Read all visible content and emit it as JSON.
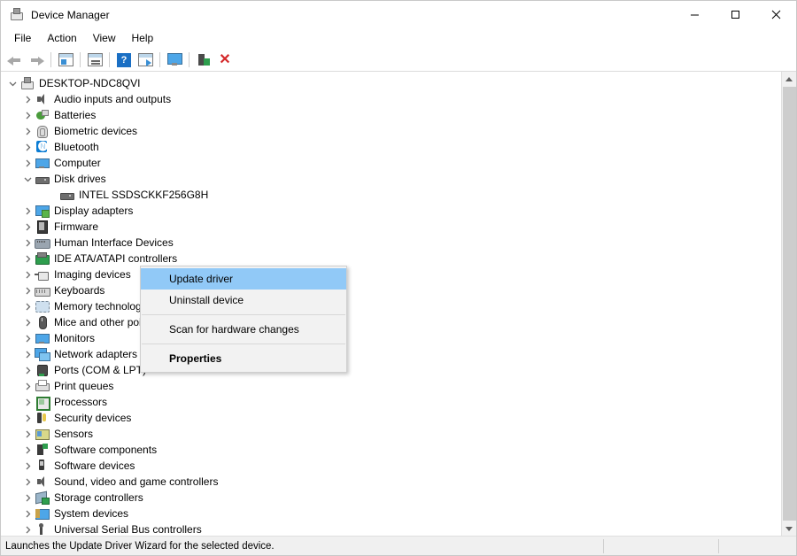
{
  "window": {
    "title": "Device Manager",
    "icon": "device-manager-icon",
    "controls": {
      "minimize": "—",
      "maximize": "☐",
      "close": "✕"
    }
  },
  "menubar": {
    "items": [
      {
        "label": "File"
      },
      {
        "label": "Action"
      },
      {
        "label": "View"
      },
      {
        "label": "Help"
      }
    ]
  },
  "toolbar": {
    "buttons": [
      {
        "name": "back-icon",
        "title": "Back"
      },
      {
        "name": "forward-icon",
        "title": "Forward"
      },
      {
        "name": "show-hide-console-tree-icon",
        "title": "Show/Hide Console Tree"
      },
      {
        "name": "properties-icon",
        "title": "Properties"
      },
      {
        "name": "help-icon",
        "title": "Help"
      },
      {
        "name": "update-driver-icon",
        "title": "Update Driver"
      },
      {
        "name": "scan-for-hardware-changes-icon",
        "title": "Scan for hardware changes"
      },
      {
        "name": "disable-device-icon",
        "title": "Disable device"
      },
      {
        "name": "uninstall-device-icon",
        "title": "Uninstall device"
      }
    ]
  },
  "tree": {
    "nodes": [
      {
        "label": "DESKTOP-NDC8QVI",
        "depth": 0,
        "state": "expanded",
        "icon": "computer-root-icon",
        "iconclass": "i-pc"
      },
      {
        "label": "Audio inputs and outputs",
        "depth": 1,
        "state": "collapsed",
        "icon": "audio-icon",
        "iconclass": "i-speaker"
      },
      {
        "label": "Batteries",
        "depth": 1,
        "state": "collapsed",
        "icon": "battery-icon",
        "iconclass": "i-batt"
      },
      {
        "label": "Biometric devices",
        "depth": 1,
        "state": "collapsed",
        "icon": "fingerprint-icon",
        "iconclass": "i-finger"
      },
      {
        "label": "Bluetooth",
        "depth": 1,
        "state": "collapsed",
        "icon": "bluetooth-icon",
        "iconclass": "i-bt"
      },
      {
        "label": "Computer",
        "depth": 1,
        "state": "collapsed",
        "icon": "computer-icon",
        "iconclass": "i-monitor"
      },
      {
        "label": "Disk drives",
        "depth": 1,
        "state": "expanded",
        "icon": "disk-drive-icon",
        "iconclass": "i-disk"
      },
      {
        "label": "INTEL SSDSCKKF256G8H",
        "depth": 2,
        "state": "leaf",
        "icon": "disk-drive-icon",
        "iconclass": "i-disk"
      },
      {
        "label": "Display adapters",
        "depth": 1,
        "state": "collapsed",
        "icon": "display-adapter-icon",
        "iconclass": "i-display"
      },
      {
        "label": "Firmware",
        "depth": 1,
        "state": "collapsed",
        "icon": "firmware-icon",
        "iconclass": "i-fw"
      },
      {
        "label": "Human Interface Devices",
        "depth": 1,
        "state": "collapsed",
        "icon": "human-interface-device-icon",
        "iconclass": "i-hid"
      },
      {
        "label": "IDE ATA/ATAPI controllers",
        "depth": 1,
        "state": "collapsed",
        "icon": "ide-controller-icon",
        "iconclass": "i-ide"
      },
      {
        "label": "Imaging devices",
        "depth": 1,
        "state": "collapsed",
        "icon": "imaging-device-icon",
        "iconclass": "i-imaging"
      },
      {
        "label": "Keyboards",
        "depth": 1,
        "state": "collapsed",
        "icon": "keyboard-icon",
        "iconclass": "i-kbd"
      },
      {
        "label": "Memory technology devices",
        "depth": 1,
        "state": "collapsed",
        "icon": "memory-technology-icon",
        "iconclass": "i-mem"
      },
      {
        "label": "Mice and other pointing devices",
        "depth": 1,
        "state": "collapsed",
        "icon": "mouse-icon",
        "iconclass": "i-mouse"
      },
      {
        "label": "Monitors",
        "depth": 1,
        "state": "collapsed",
        "icon": "monitor-icon",
        "iconclass": "i-monitor"
      },
      {
        "label": "Network adapters",
        "depth": 1,
        "state": "collapsed",
        "icon": "network-adapter-icon",
        "iconclass": "i-net"
      },
      {
        "label": "Ports (COM & LPT)",
        "depth": 1,
        "state": "collapsed",
        "icon": "port-icon",
        "iconclass": "i-port"
      },
      {
        "label": "Print queues",
        "depth": 1,
        "state": "collapsed",
        "icon": "printer-icon",
        "iconclass": "i-print"
      },
      {
        "label": "Processors",
        "depth": 1,
        "state": "collapsed",
        "icon": "processor-icon",
        "iconclass": "i-cpu"
      },
      {
        "label": "Security devices",
        "depth": 1,
        "state": "collapsed",
        "icon": "security-device-icon",
        "iconclass": "i-sec"
      },
      {
        "label": "Sensors",
        "depth": 1,
        "state": "collapsed",
        "icon": "sensor-icon",
        "iconclass": "i-sensor"
      },
      {
        "label": "Software components",
        "depth": 1,
        "state": "collapsed",
        "icon": "software-component-icon",
        "iconclass": "i-swcomp"
      },
      {
        "label": "Software devices",
        "depth": 1,
        "state": "collapsed",
        "icon": "software-device-icon",
        "iconclass": "i-swdev"
      },
      {
        "label": "Sound, video and game controllers",
        "depth": 1,
        "state": "collapsed",
        "icon": "sound-controller-icon",
        "iconclass": "i-speaker"
      },
      {
        "label": "Storage controllers",
        "depth": 1,
        "state": "collapsed",
        "icon": "storage-controller-icon",
        "iconclass": "i-storage"
      },
      {
        "label": "System devices",
        "depth": 1,
        "state": "collapsed",
        "icon": "system-device-icon",
        "iconclass": "i-sysdev"
      },
      {
        "label": "Universal Serial Bus controllers",
        "depth": 1,
        "state": "collapsed",
        "icon": "usb-controller-icon",
        "iconclass": "i-usb"
      }
    ],
    "chevron_expanded": "⌄",
    "chevron_collapsed": "›"
  },
  "context_menu": {
    "items": [
      {
        "label": "Update driver",
        "selected": true,
        "bold": false,
        "separator_after": false
      },
      {
        "label": "Uninstall device",
        "selected": false,
        "bold": false,
        "separator_after": true
      },
      {
        "label": "Scan for hardware changes",
        "selected": false,
        "bold": false,
        "separator_after": true
      },
      {
        "label": "Properties",
        "selected": false,
        "bold": true,
        "separator_after": false
      }
    ],
    "highlight_color": "#91c9f7"
  },
  "scrollbar": {
    "up_arrow": "▲",
    "down_arrow": "▼"
  },
  "statusbar": {
    "message": "Launches the Update Driver Wizard for the selected device.",
    "pane2": "",
    "pane3": ""
  }
}
